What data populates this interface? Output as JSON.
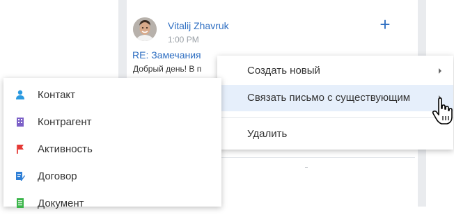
{
  "email": {
    "sender": "Vitalij Zhavruk",
    "time": "1:00 PM",
    "subject": "RE: Замечания",
    "preview": "Добрый день! В п"
  },
  "context_menu": {
    "items": [
      {
        "label": "Создать новый",
        "has_submenu": true
      },
      {
        "label": "Связать письмо с существующим",
        "has_submenu": true,
        "highlighted": true
      },
      {
        "label": "Удалить",
        "has_submenu": false
      }
    ]
  },
  "submenu": {
    "items": [
      {
        "label": "Контакт",
        "icon": "contact-icon",
        "color": "#2b9ae0"
      },
      {
        "label": "Контрагент",
        "icon": "account-icon",
        "color": "#7b5fc7"
      },
      {
        "label": "Активность",
        "icon": "activity-flag-icon",
        "color": "#e53935"
      },
      {
        "label": "Договор",
        "icon": "contract-icon",
        "color": "#2f7fd6"
      },
      {
        "label": "Документ",
        "icon": "document-icon",
        "color": "#3bb54a"
      }
    ]
  },
  "colors": {
    "accent": "#2f6fc2",
    "highlight": "#e6effb"
  }
}
